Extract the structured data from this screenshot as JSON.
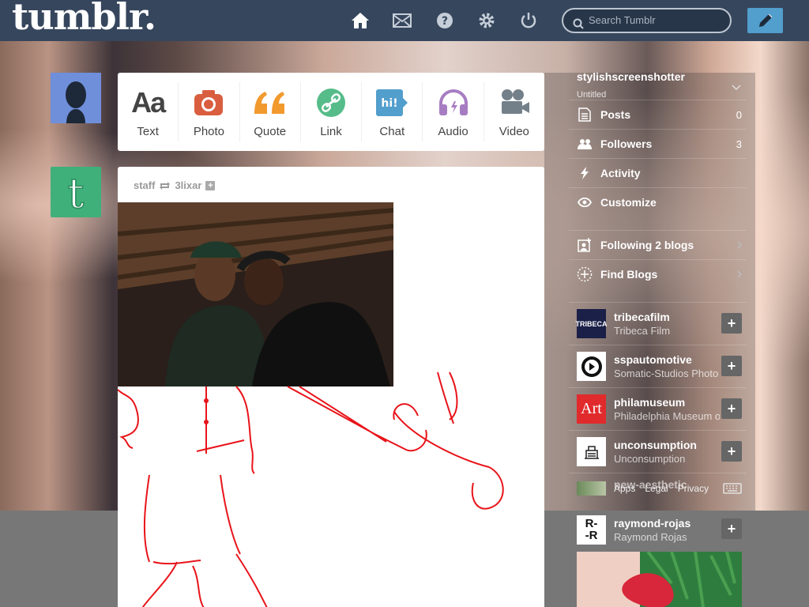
{
  "header": {
    "logo": "tumblr.",
    "search_placeholder": "Search Tumblr",
    "nav": [
      "home-icon",
      "mail-icon",
      "help-icon",
      "settings-icon",
      "power-icon"
    ],
    "accent": "#529ecc",
    "bg": "#36465d"
  },
  "composer": [
    {
      "label": "Text",
      "color": "#444444"
    },
    {
      "label": "Photo",
      "color": "#d95e40"
    },
    {
      "label": "Quote",
      "color": "#f2992e"
    },
    {
      "label": "Link",
      "color": "#56bc8a"
    },
    {
      "label": "Chat",
      "color": "#529ecc"
    },
    {
      "label": "Audio",
      "color": "#a77dc2"
    },
    {
      "label": "Video",
      "color": "#748089"
    }
  ],
  "post": {
    "author": "staff",
    "reblog_from": "3lixar"
  },
  "sidebar": {
    "blog_name": "stylishscreenshotter",
    "blog_title": "Untitled",
    "items": [
      {
        "label": "Posts",
        "count": "0"
      },
      {
        "label": "Followers",
        "count": "3"
      },
      {
        "label": "Activity",
        "count": ""
      },
      {
        "label": "Customize",
        "count": ""
      }
    ],
    "following": "Following 2 blogs",
    "find": "Find Blogs",
    "recommended": [
      {
        "name": "tribecafilm",
        "desc": "Tribeca Film",
        "thumb": "TRIBECA"
      },
      {
        "name": "sspautomotive",
        "desc": "Somatic-Studios Photo",
        "thumb": ""
      },
      {
        "name": "philamuseum",
        "desc": "Philadelphia Museum of",
        "thumb": "Art"
      },
      {
        "name": "unconsumption",
        "desc": "Unconsumption",
        "thumb": ""
      },
      {
        "name": "new-aesthetic",
        "desc": "",
        "thumb": ""
      },
      {
        "name": "raymond-rojas",
        "desc": "Raymond Rojas",
        "thumb": "R-\n-R"
      }
    ],
    "footer": {
      "apps": "Apps",
      "legal": "Legal",
      "privacy": "Privacy"
    }
  }
}
